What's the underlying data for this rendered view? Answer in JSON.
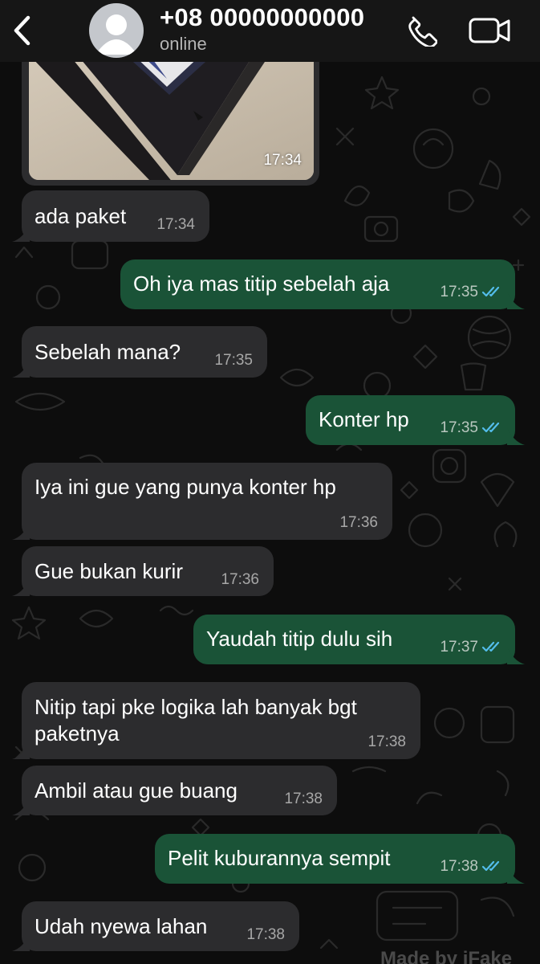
{
  "header": {
    "contact_name": "+08 00000000000",
    "status": "online",
    "back_icon": "chevron-left-icon",
    "call_icon": "phone-icon",
    "video_icon": "video-camera-icon"
  },
  "image_message": {
    "time": "17:34"
  },
  "messages": [
    {
      "direction": "in",
      "text": "ada paket",
      "time": "17:34"
    },
    {
      "direction": "out",
      "text": "Oh iya mas titip sebelah aja",
      "time": "17:35",
      "status": "read"
    },
    {
      "direction": "in",
      "text": "Sebelah mana?",
      "time": "17:35"
    },
    {
      "direction": "out",
      "text": "Konter hp",
      "time": "17:35",
      "status": "read"
    },
    {
      "direction": "in",
      "text": "Iya ini gue yang punya konter hp",
      "time": "17:36"
    },
    {
      "direction": "in",
      "text": "Gue bukan kurir",
      "time": "17:36"
    },
    {
      "direction": "out",
      "text": "Yaudah titip dulu sih",
      "time": "17:37",
      "status": "read"
    },
    {
      "direction": "in",
      "text_line1": "Nitip tapi pke logika lah banyak bgt",
      "text_line2": "paketnya",
      "time": "17:38"
    },
    {
      "direction": "in",
      "text": "Ambil atau gue buang",
      "time": "17:38"
    },
    {
      "direction": "out",
      "text": "Pelit kuburannya sempit",
      "time": "17:38",
      "status": "read"
    },
    {
      "direction": "in",
      "text": "Udah nyewa lahan",
      "time": "17:38"
    }
  ],
  "watermark": "Made by iFake",
  "colors": {
    "background": "#0d0d0d",
    "header": "#161616",
    "incoming_bubble": "#2c2c2e",
    "outgoing_bubble": "#1a5337",
    "read_ticks": "#53bdeb"
  }
}
